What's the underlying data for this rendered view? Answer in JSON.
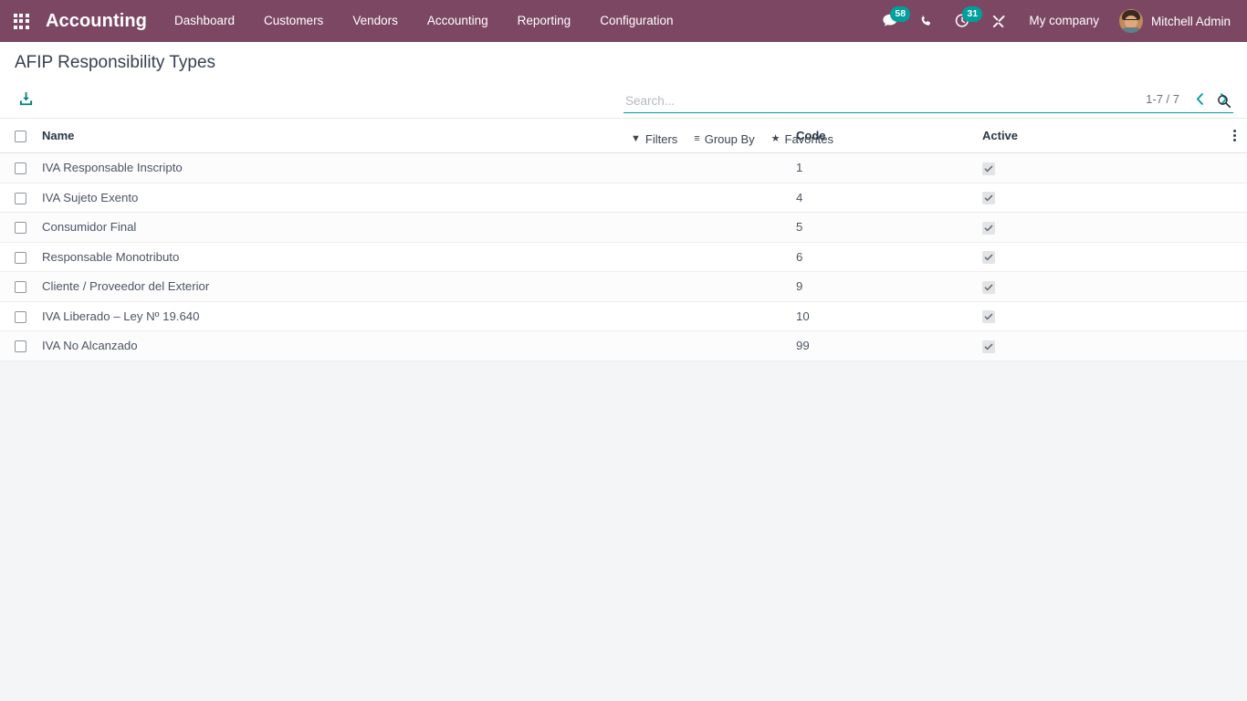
{
  "navbar": {
    "apps_icon": "grid-apps-icon",
    "brand": "Accounting",
    "menu_items": [
      {
        "label": "Dashboard"
      },
      {
        "label": "Customers"
      },
      {
        "label": "Vendors"
      },
      {
        "label": "Accounting"
      },
      {
        "label": "Reporting"
      },
      {
        "label": "Configuration"
      }
    ],
    "systray": {
      "messages_icon": "comment-icon",
      "messages_badge": "58",
      "phone_icon": "phone-icon",
      "activities_icon": "clock-icon",
      "activities_badge": "31",
      "debug_icon": "wrench-icon",
      "company": "My company",
      "user": "Mitchell Admin"
    }
  },
  "control_panel": {
    "breadcrumb": "AFIP Responsibility Types",
    "import_icon": "download-import-icon",
    "search": {
      "placeholder": "Search...",
      "value": "",
      "icon": "search-icon"
    },
    "filters": [
      {
        "glyph": "▼",
        "label": "Filters",
        "name": "filters"
      },
      {
        "glyph": "≡",
        "label": "Group By",
        "name": "group-by"
      },
      {
        "glyph": "★",
        "label": "Favorites",
        "name": "favorites"
      }
    ],
    "pager": {
      "count": "1-7 / 7",
      "prev_icon": "chevron-left-icon",
      "next_icon": "chevron-right-icon"
    }
  },
  "list": {
    "select_all_checkbox": "select-all",
    "columns": [
      {
        "key": "name",
        "label": "Name"
      },
      {
        "key": "code",
        "label": "Code"
      },
      {
        "key": "active",
        "label": "Active"
      }
    ],
    "optional_columns_icon": "vertical-ellipsis-icon",
    "rows": [
      {
        "name": "IVA Responsable Inscripto",
        "code": "1",
        "active": true
      },
      {
        "name": "IVA Sujeto Exento",
        "code": "4",
        "active": true
      },
      {
        "name": "Consumidor Final",
        "code": "5",
        "active": true
      },
      {
        "name": "Responsable Monotributo",
        "code": "6",
        "active": true
      },
      {
        "name": "Cliente / Proveedor del Exterior",
        "code": "9",
        "active": true
      },
      {
        "name": "IVA Liberado – Ley Nº 19.640",
        "code": "10",
        "active": true
      },
      {
        "name": "IVA No Alcanzado",
        "code": "99",
        "active": true
      }
    ]
  },
  "colors": {
    "navbar_bg": "#7c4762",
    "accent_teal": "#00a09d",
    "badge_bg": "#00a09d",
    "page_bg": "#f4f5f7"
  }
}
